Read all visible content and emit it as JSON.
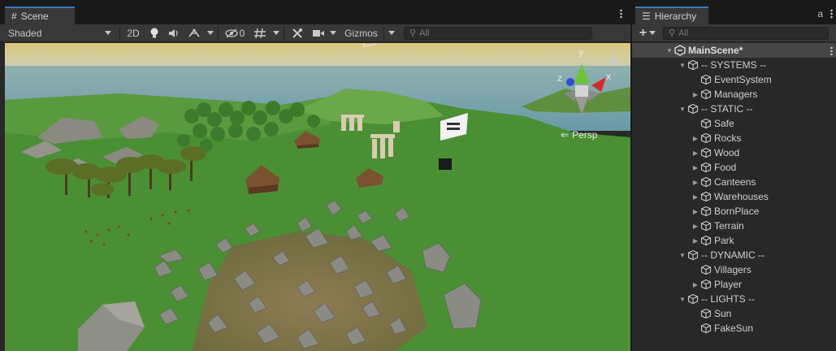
{
  "scene": {
    "tab_label": "Scene",
    "tab_icon": "#",
    "shading_mode": "Shaded",
    "mode_2d": "2D",
    "hidden_count": "0",
    "gizmos_label": "Gizmos",
    "search_placeholder": "All",
    "persp_label": "Persp",
    "axes": {
      "y": "y",
      "x": "x",
      "z": "z"
    }
  },
  "hierarchy": {
    "tab_label": "Hierarchy",
    "tab_icon": "☰",
    "lock_icon": "a",
    "add_label": "+",
    "search_placeholder": "All",
    "items": [
      {
        "label": "MainScene*",
        "depth": 0,
        "fold": "open",
        "kind": "scene"
      },
      {
        "label": "-- SYSTEMS --",
        "depth": 1,
        "fold": "open",
        "kind": "object"
      },
      {
        "label": "EventSystem",
        "depth": 2,
        "fold": "none",
        "kind": "object"
      },
      {
        "label": "Managers",
        "depth": 2,
        "fold": "closed",
        "kind": "object"
      },
      {
        "label": "-- STATIC --",
        "depth": 1,
        "fold": "open",
        "kind": "object"
      },
      {
        "label": "Safe",
        "depth": 2,
        "fold": "none",
        "kind": "object"
      },
      {
        "label": "Rocks",
        "depth": 2,
        "fold": "closed",
        "kind": "object"
      },
      {
        "label": "Wood",
        "depth": 2,
        "fold": "closed",
        "kind": "object"
      },
      {
        "label": "Food",
        "depth": 2,
        "fold": "closed",
        "kind": "object"
      },
      {
        "label": "Canteens",
        "depth": 2,
        "fold": "closed",
        "kind": "object"
      },
      {
        "label": "Warehouses",
        "depth": 2,
        "fold": "closed",
        "kind": "object"
      },
      {
        "label": "BornPlace",
        "depth": 2,
        "fold": "closed",
        "kind": "object"
      },
      {
        "label": "Terrain",
        "depth": 2,
        "fold": "closed",
        "kind": "object"
      },
      {
        "label": "Park",
        "depth": 2,
        "fold": "closed",
        "kind": "object"
      },
      {
        "label": "-- DYNAMIC --",
        "depth": 1,
        "fold": "open",
        "kind": "object"
      },
      {
        "label": "Villagers",
        "depth": 2,
        "fold": "none",
        "kind": "object"
      },
      {
        "label": "Player",
        "depth": 2,
        "fold": "closed",
        "kind": "object"
      },
      {
        "label": "-- LIGHTS --",
        "depth": 1,
        "fold": "open",
        "kind": "object"
      },
      {
        "label": "Sun",
        "depth": 2,
        "fold": "none",
        "kind": "object"
      },
      {
        "label": "FakeSun",
        "depth": 2,
        "fold": "none",
        "kind": "object"
      }
    ]
  }
}
